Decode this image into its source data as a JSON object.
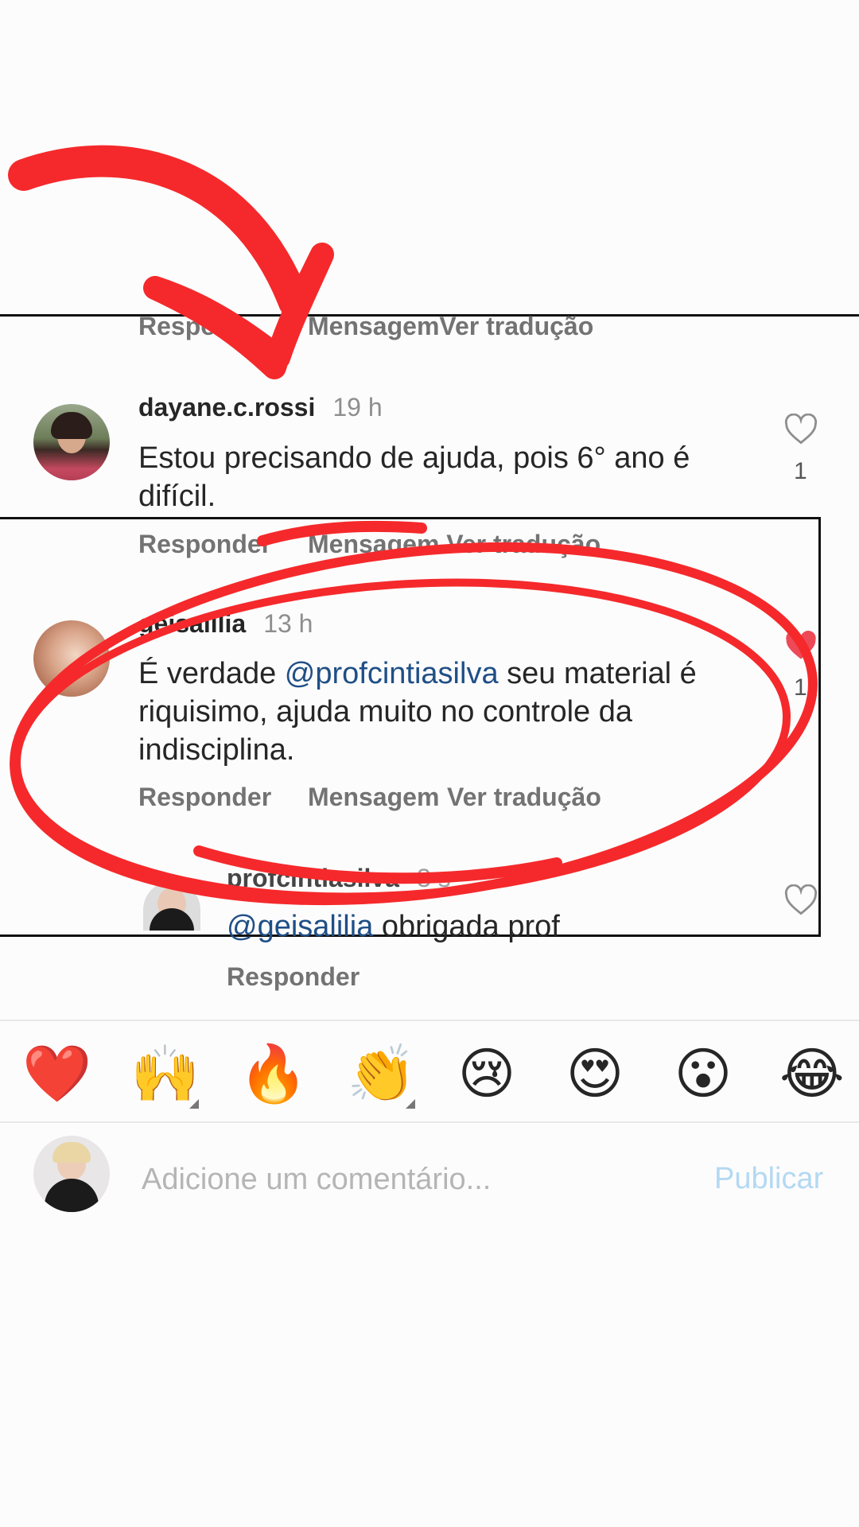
{
  "top_actions": {
    "reply": "Respon",
    "message_translate": "MensagemVer tradução"
  },
  "comments": [
    {
      "username": "dayane.c.rossi",
      "time": "19 h",
      "text": "Estou precisando de ajuda, pois 6° ano é difícil.",
      "likes": "1",
      "reply_label": "Responder",
      "message_translate_label": "Mensagem Ver tradução"
    },
    {
      "username": "geisalilia",
      "time": "13 h",
      "text_before": "É verdade ",
      "mention": "@profcintiasilva",
      "text_after": " seu material é riquisimo, ajuda muito no controle da indisciplina.",
      "likes": "1",
      "reply_label": "Responder",
      "message_label": "Mensagem",
      "translate_label": "Ver tradução"
    },
    {
      "username": "profcintiasilva",
      "time": "3 s",
      "mention": "@geisalilia",
      "text_after": " obrigada prof",
      "reply_label": "Responder"
    }
  ],
  "emoji_bar": [
    {
      "icon": "red-heart-emoji",
      "char": "❤️"
    },
    {
      "icon": "raising-hands-emoji",
      "char": "🙌"
    },
    {
      "icon": "fire-emoji",
      "char": "🔥"
    },
    {
      "icon": "clapping-hands-emoji",
      "char": "👏"
    },
    {
      "icon": "crying-face-emoji",
      "char": "😢"
    },
    {
      "icon": "heart-eyes-emoji",
      "char": "😍"
    },
    {
      "icon": "surprised-face-emoji",
      "char": "😮"
    },
    {
      "icon": "tears-of-joy-emoji",
      "char": "😂"
    }
  ],
  "composer": {
    "placeholder": "Adicione um comentário...",
    "publish_label": "Publicar"
  },
  "colors": {
    "annotation_red": "#f5292b",
    "mention_blue": "#1f4f86",
    "publish_blue": "#b3d9f2",
    "like_red": "#ed4956"
  }
}
